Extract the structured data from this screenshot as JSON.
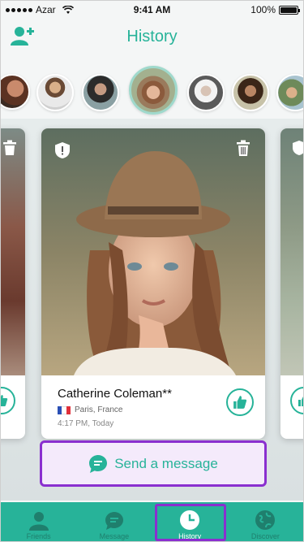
{
  "status_bar": {
    "carrier": "Azar",
    "time": "9:41 AM",
    "battery": "100%"
  },
  "header": {
    "title": "History"
  },
  "card": {
    "name": "Catherine Coleman**",
    "location": "Paris, France",
    "timestamp": "4:17 PM, Today"
  },
  "send_message": {
    "label": "Send a message"
  },
  "tabs": [
    {
      "label": "Friends",
      "icon": "friends-icon"
    },
    {
      "label": "Message",
      "icon": "message-icon"
    },
    {
      "label": "History",
      "icon": "history-icon"
    },
    {
      "label": "Discover",
      "icon": "discover-icon"
    }
  ],
  "colors": {
    "accent": "#27b399",
    "highlight": "#8a2fcf"
  }
}
